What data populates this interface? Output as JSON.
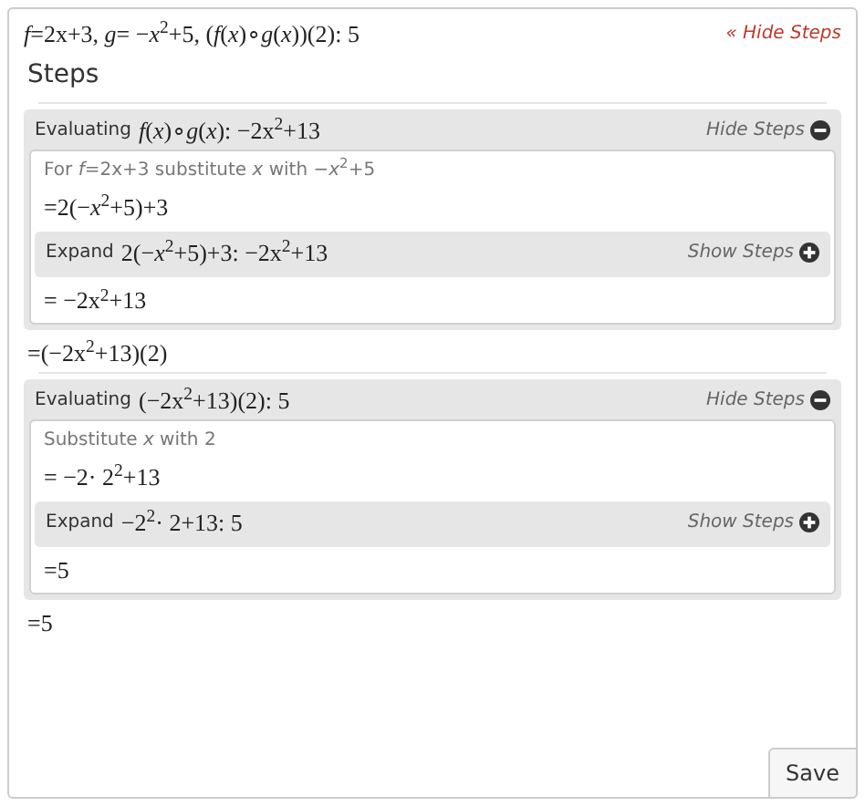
{
  "header": {
    "problem": "*f*=2x+3, *g*= −*x*$^{2}$+5, (*f*(*x*)∘*g*(*x*))(2):   5",
    "toggle": "« Hide Steps"
  },
  "steps_title": "Steps",
  "sections": [
    {
      "kind": "block",
      "label": "Evaluating",
      "math": "*f*(*x*)∘*g*(*x*):   −2x$^{2}$+13",
      "toggle": "Hide Steps",
      "expanded": true,
      "items": [
        {
          "kind": "note",
          "text": "For *f*=2x+3 substitute *x* with  −*x*$^{2}$+5"
        },
        {
          "kind": "line",
          "text": "=2(−*x*$^{2}$+5)+3"
        },
        {
          "kind": "block",
          "label": "Expand",
          "math": "2(−*x*$^{2}$+5)+3:   −2x$^{2}$+13",
          "toggle": "Show Steps",
          "expanded": false
        },
        {
          "kind": "line",
          "text": "= −2x$^{2}$+13"
        }
      ]
    },
    {
      "kind": "line",
      "text": "=(−2x$^{2}$+13)(2)"
    },
    {
      "kind": "block",
      "label": "Evaluating",
      "math": "(−2x$^{2}$+13)(2):   5",
      "toggle": "Hide Steps",
      "expanded": true,
      "items": [
        {
          "kind": "note",
          "text": "Substitute *x* with 2"
        },
        {
          "kind": "line",
          "text": "= −2· 2$^{2}$+13"
        },
        {
          "kind": "block",
          "label": "Expand",
          "math": "−2$^{2}$· 2+13:   5",
          "toggle": "Show Steps",
          "expanded": false
        },
        {
          "kind": "line",
          "text": "=5"
        }
      ]
    },
    {
      "kind": "line",
      "text": "=5"
    }
  ],
  "save_button": "Save"
}
